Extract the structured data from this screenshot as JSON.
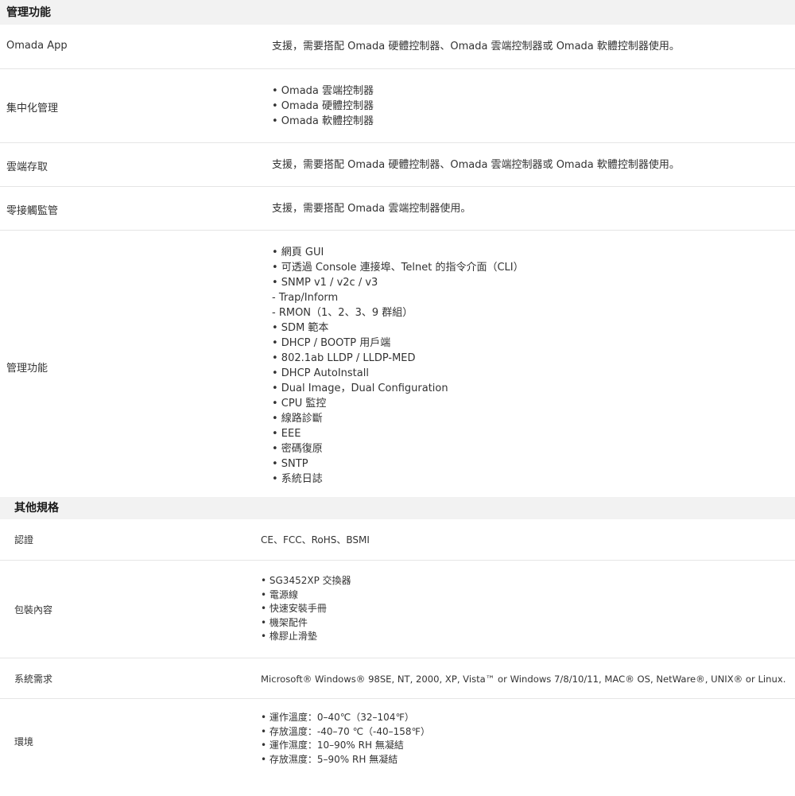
{
  "management": {
    "header": "管理功能",
    "rows": [
      {
        "label": "Omada App",
        "value": "支援，需要搭配 Omada 硬體控制器、Omada 雲端控制器或 Omada 軟體控制器使用。"
      },
      {
        "label": "集中化管理",
        "items": [
          "• Omada 雲端控制器",
          "• Omada 硬體控制器",
          "• Omada 軟體控制器"
        ]
      },
      {
        "label": "雲端存取",
        "value": "支援，需要搭配 Omada 硬體控制器、Omada 雲端控制器或 Omada 軟體控制器使用。"
      },
      {
        "label": "零接觸監管",
        "value": "支援，需要搭配 Omada 雲端控制器使用。"
      },
      {
        "label": "管理功能",
        "items": [
          "• 網頁 GUI",
          "• 可透過 Console 連接埠、Telnet 的指令介面（CLI）",
          "• SNMP v1 / v2c / v3",
          "- Trap/Inform",
          "- RMON（1、2、3、9 群組）",
          "• SDM 範本",
          "• DHCP / BOOTP 用戶端",
          "• 802.1ab LLDP / LLDP-MED",
          "• DHCP AutoInstall",
          "• Dual Image，Dual Configuration",
          "• CPU 監控",
          "• 線路診斷",
          "• EEE",
          "• 密碼復原",
          "• SNTP",
          "• 系統日誌"
        ]
      }
    ]
  },
  "other": {
    "header": "其他規格",
    "rows": [
      {
        "label": "認證",
        "value": "CE、FCC、RoHS、BSMI"
      },
      {
        "label": "包裝內容",
        "items": [
          "• SG3452XP 交換器",
          "• 電源線",
          "• 快速安裝手冊",
          "• 機架配件",
          "• 橡膠止滑墊"
        ]
      },
      {
        "label": "系統需求",
        "value": "Microsoft® Windows® 98SE, NT, 2000, XP, Vista™ or Windows 7/8/10/11, MAC® OS, NetWare®, UNIX® or Linux."
      },
      {
        "label": "環境",
        "items": [
          "• 運作溫度：0–40℃（32–104℉）",
          "• 存放溫度：-40–70 ℃（-40–158℉）",
          "• 運作濕度：10–90% RH 無凝結",
          "• 存放濕度：5–90% RH 無凝結"
        ]
      }
    ]
  }
}
